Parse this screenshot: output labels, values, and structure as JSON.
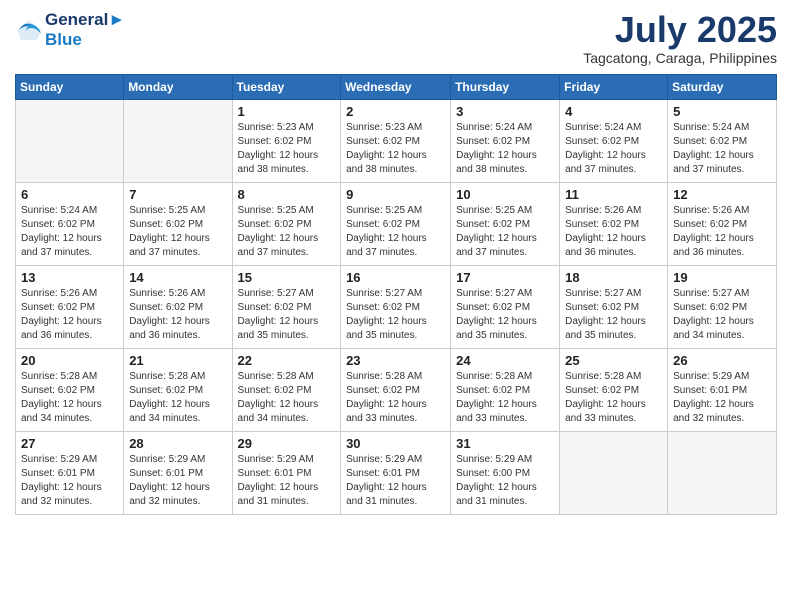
{
  "header": {
    "logo_line1": "General",
    "logo_line2": "Blue",
    "month": "July 2025",
    "location": "Tagcatong, Caraga, Philippines"
  },
  "weekdays": [
    "Sunday",
    "Monday",
    "Tuesday",
    "Wednesday",
    "Thursday",
    "Friday",
    "Saturday"
  ],
  "weeks": [
    [
      {
        "day": "",
        "info": ""
      },
      {
        "day": "",
        "info": ""
      },
      {
        "day": "1",
        "info": "Sunrise: 5:23 AM\nSunset: 6:02 PM\nDaylight: 12 hours\nand 38 minutes."
      },
      {
        "day": "2",
        "info": "Sunrise: 5:23 AM\nSunset: 6:02 PM\nDaylight: 12 hours\nand 38 minutes."
      },
      {
        "day": "3",
        "info": "Sunrise: 5:24 AM\nSunset: 6:02 PM\nDaylight: 12 hours\nand 38 minutes."
      },
      {
        "day": "4",
        "info": "Sunrise: 5:24 AM\nSunset: 6:02 PM\nDaylight: 12 hours\nand 37 minutes."
      },
      {
        "day": "5",
        "info": "Sunrise: 5:24 AM\nSunset: 6:02 PM\nDaylight: 12 hours\nand 37 minutes."
      }
    ],
    [
      {
        "day": "6",
        "info": "Sunrise: 5:24 AM\nSunset: 6:02 PM\nDaylight: 12 hours\nand 37 minutes."
      },
      {
        "day": "7",
        "info": "Sunrise: 5:25 AM\nSunset: 6:02 PM\nDaylight: 12 hours\nand 37 minutes."
      },
      {
        "day": "8",
        "info": "Sunrise: 5:25 AM\nSunset: 6:02 PM\nDaylight: 12 hours\nand 37 minutes."
      },
      {
        "day": "9",
        "info": "Sunrise: 5:25 AM\nSunset: 6:02 PM\nDaylight: 12 hours\nand 37 minutes."
      },
      {
        "day": "10",
        "info": "Sunrise: 5:25 AM\nSunset: 6:02 PM\nDaylight: 12 hours\nand 37 minutes."
      },
      {
        "day": "11",
        "info": "Sunrise: 5:26 AM\nSunset: 6:02 PM\nDaylight: 12 hours\nand 36 minutes."
      },
      {
        "day": "12",
        "info": "Sunrise: 5:26 AM\nSunset: 6:02 PM\nDaylight: 12 hours\nand 36 minutes."
      }
    ],
    [
      {
        "day": "13",
        "info": "Sunrise: 5:26 AM\nSunset: 6:02 PM\nDaylight: 12 hours\nand 36 minutes."
      },
      {
        "day": "14",
        "info": "Sunrise: 5:26 AM\nSunset: 6:02 PM\nDaylight: 12 hours\nand 36 minutes."
      },
      {
        "day": "15",
        "info": "Sunrise: 5:27 AM\nSunset: 6:02 PM\nDaylight: 12 hours\nand 35 minutes."
      },
      {
        "day": "16",
        "info": "Sunrise: 5:27 AM\nSunset: 6:02 PM\nDaylight: 12 hours\nand 35 minutes."
      },
      {
        "day": "17",
        "info": "Sunrise: 5:27 AM\nSunset: 6:02 PM\nDaylight: 12 hours\nand 35 minutes."
      },
      {
        "day": "18",
        "info": "Sunrise: 5:27 AM\nSunset: 6:02 PM\nDaylight: 12 hours\nand 35 minutes."
      },
      {
        "day": "19",
        "info": "Sunrise: 5:27 AM\nSunset: 6:02 PM\nDaylight: 12 hours\nand 34 minutes."
      }
    ],
    [
      {
        "day": "20",
        "info": "Sunrise: 5:28 AM\nSunset: 6:02 PM\nDaylight: 12 hours\nand 34 minutes."
      },
      {
        "day": "21",
        "info": "Sunrise: 5:28 AM\nSunset: 6:02 PM\nDaylight: 12 hours\nand 34 minutes."
      },
      {
        "day": "22",
        "info": "Sunrise: 5:28 AM\nSunset: 6:02 PM\nDaylight: 12 hours\nand 34 minutes."
      },
      {
        "day": "23",
        "info": "Sunrise: 5:28 AM\nSunset: 6:02 PM\nDaylight: 12 hours\nand 33 minutes."
      },
      {
        "day": "24",
        "info": "Sunrise: 5:28 AM\nSunset: 6:02 PM\nDaylight: 12 hours\nand 33 minutes."
      },
      {
        "day": "25",
        "info": "Sunrise: 5:28 AM\nSunset: 6:02 PM\nDaylight: 12 hours\nand 33 minutes."
      },
      {
        "day": "26",
        "info": "Sunrise: 5:29 AM\nSunset: 6:01 PM\nDaylight: 12 hours\nand 32 minutes."
      }
    ],
    [
      {
        "day": "27",
        "info": "Sunrise: 5:29 AM\nSunset: 6:01 PM\nDaylight: 12 hours\nand 32 minutes."
      },
      {
        "day": "28",
        "info": "Sunrise: 5:29 AM\nSunset: 6:01 PM\nDaylight: 12 hours\nand 32 minutes."
      },
      {
        "day": "29",
        "info": "Sunrise: 5:29 AM\nSunset: 6:01 PM\nDaylight: 12 hours\nand 31 minutes."
      },
      {
        "day": "30",
        "info": "Sunrise: 5:29 AM\nSunset: 6:01 PM\nDaylight: 12 hours\nand 31 minutes."
      },
      {
        "day": "31",
        "info": "Sunrise: 5:29 AM\nSunset: 6:00 PM\nDaylight: 12 hours\nand 31 minutes."
      },
      {
        "day": "",
        "info": ""
      },
      {
        "day": "",
        "info": ""
      }
    ]
  ]
}
